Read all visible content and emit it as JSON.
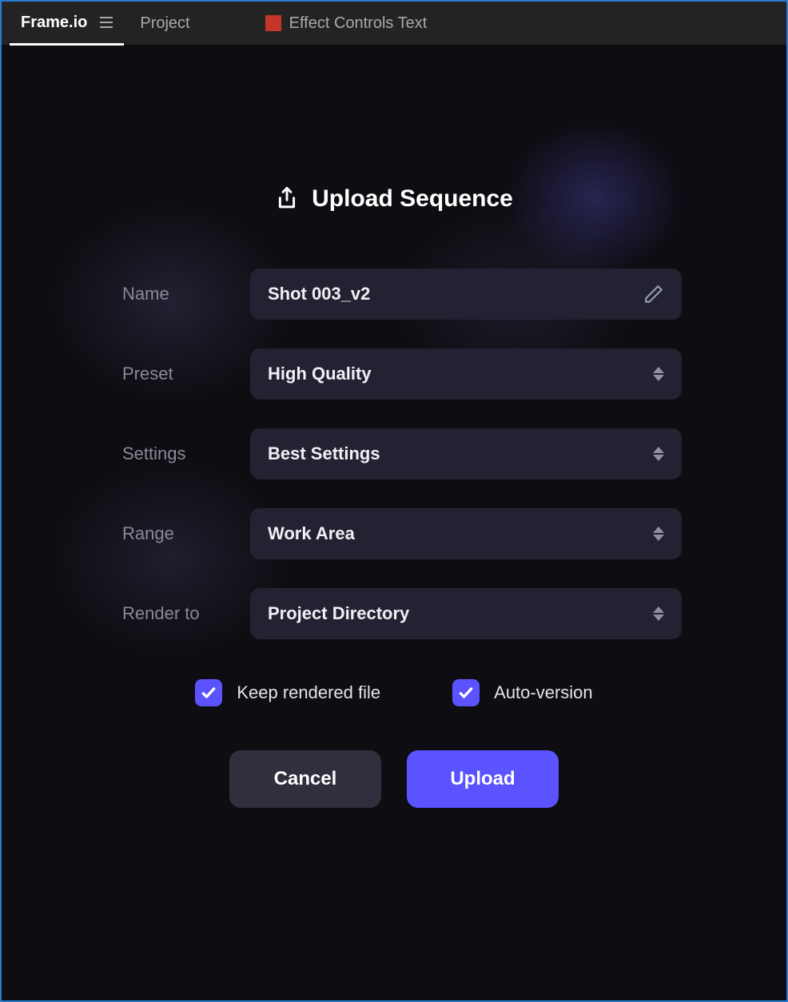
{
  "tabs": {
    "frameio": "Frame.io",
    "project": "Project",
    "effect_controls": "Effect Controls Text"
  },
  "modal": {
    "title": "Upload Sequence",
    "fields": {
      "name": {
        "label": "Name",
        "value": "Shot 003_v2"
      },
      "preset": {
        "label": "Preset",
        "value": "High Quality"
      },
      "settings": {
        "label": "Settings",
        "value": "Best Settings"
      },
      "range": {
        "label": "Range",
        "value": "Work Area"
      },
      "render_to": {
        "label": "Render to",
        "value": "Project Directory"
      }
    },
    "checkboxes": {
      "keep_rendered": {
        "label": "Keep rendered file",
        "checked": true
      },
      "auto_version": {
        "label": "Auto-version",
        "checked": true
      }
    },
    "buttons": {
      "cancel": "Cancel",
      "upload": "Upload"
    }
  },
  "colors": {
    "accent": "#5b53ff",
    "field_bg": "#222233",
    "tab_bar_bg": "#232323",
    "red_square": "#c33629"
  }
}
